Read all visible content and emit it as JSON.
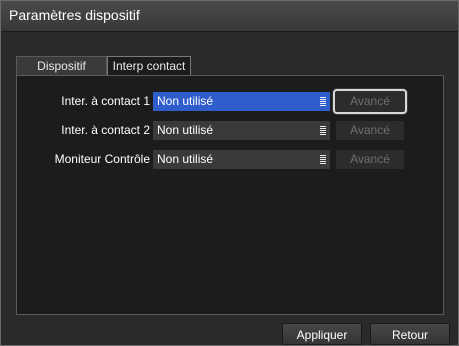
{
  "window": {
    "title": "Paramètres dispositif"
  },
  "tabs": [
    {
      "label": "Dispositif",
      "active": false
    },
    {
      "label": "Interp contact",
      "active": true
    }
  ],
  "rows": [
    {
      "label": "Inter. à contact 1",
      "value": "Non utilisé",
      "advanced_label": "Avancé",
      "selected": true
    },
    {
      "label": "Inter. à contact 2",
      "value": "Non utilisé",
      "advanced_label": "Avancé",
      "selected": false
    },
    {
      "label": "Moniteur Contrôle",
      "value": "Non utilisé",
      "advanced_label": "Avancé",
      "selected": false
    }
  ],
  "footer": {
    "apply_label": "Appliquer",
    "back_label": "Retour"
  },
  "colors": {
    "selection": "#2f5dcc",
    "background": "#1c1c1c",
    "titlebar": "#404040"
  },
  "icons": {
    "dropdown": "list-icon"
  }
}
